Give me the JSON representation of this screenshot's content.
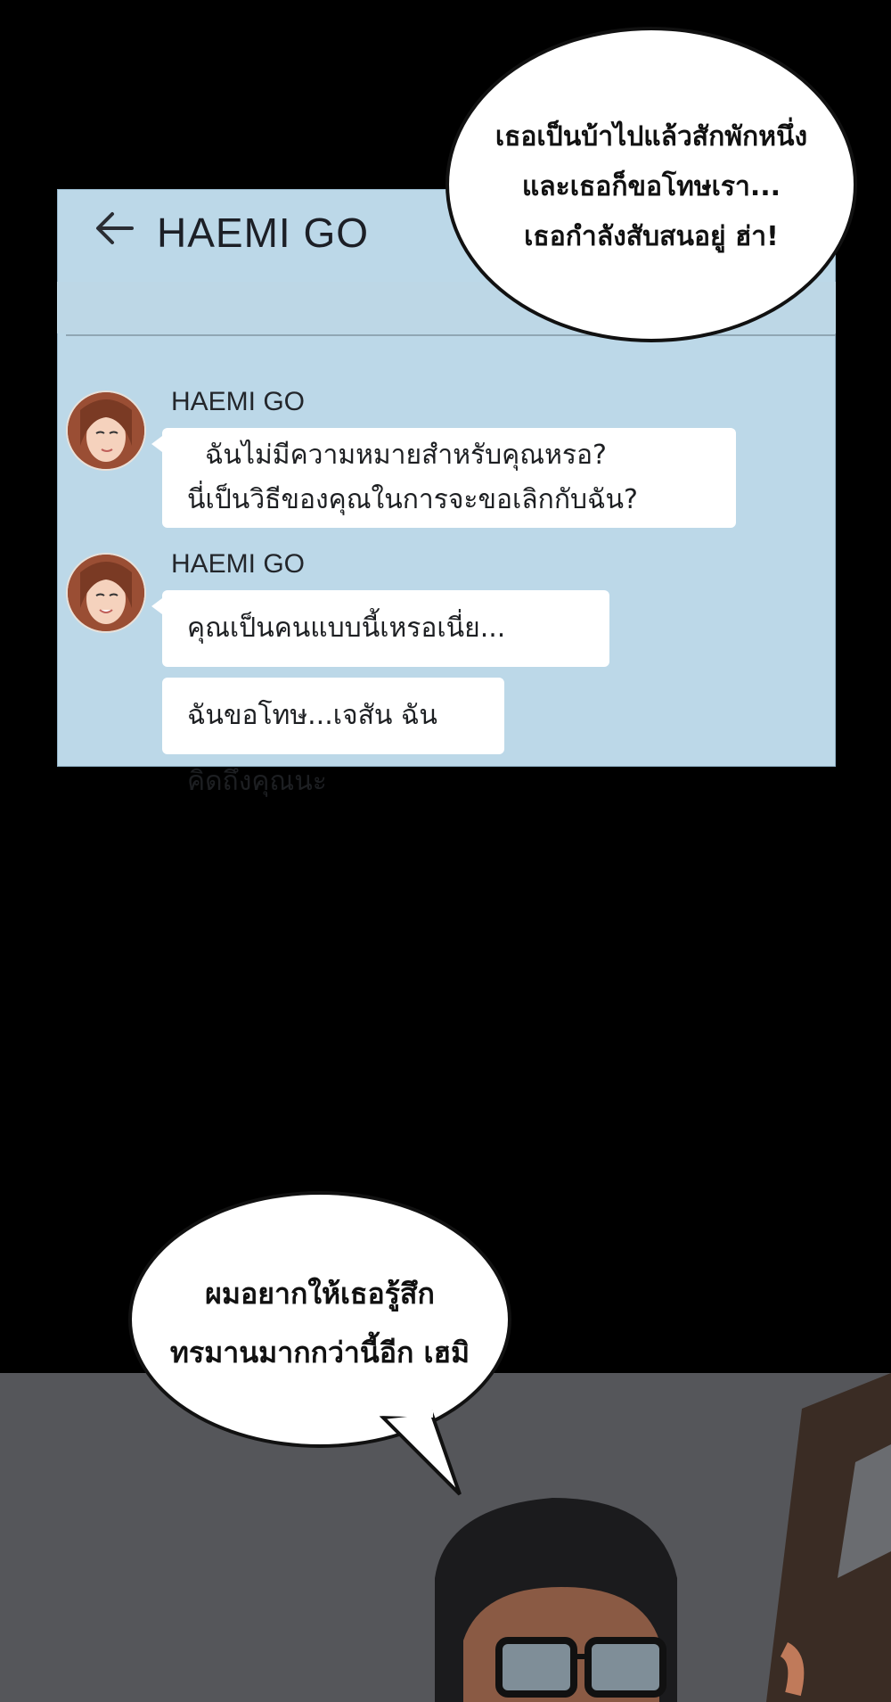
{
  "chat": {
    "title": "HAEMI GO",
    "messages": [
      {
        "sender": "HAEMI GO",
        "lines": [
          "ฉันไม่มีความหมายสำหรับคุณหรอ?",
          "นี่เป็นวิธีของคุณในการจะขอเลิกกับฉัน?"
        ]
      },
      {
        "sender": "HAEMI GO",
        "lines": [
          "คุณเป็นคนแบบนี้เหรอเนี่ย..."
        ]
      },
      {
        "sender": "",
        "lines": [
          "ฉันขอโทษ...เจสัน ฉันคิดถึงคุณนะ"
        ]
      }
    ]
  },
  "speech_top": {
    "lines": [
      "เธอเป็นบ้าไปแล้วสักพักหนึ่ง",
      "และเธอก็ขอโทษเรา...",
      "เธอกำลังสับสนอยู่ ฮ่า!"
    ]
  },
  "speech_bottom": {
    "lines": [
      "ผมอยากให้เธอรู้สึก",
      "ทรมานมากกว่านี้อีก เฮมิ"
    ]
  },
  "colors": {
    "chat_background": "#bcd8e8",
    "bubble": "#ffffff",
    "page_background": "#000000"
  }
}
